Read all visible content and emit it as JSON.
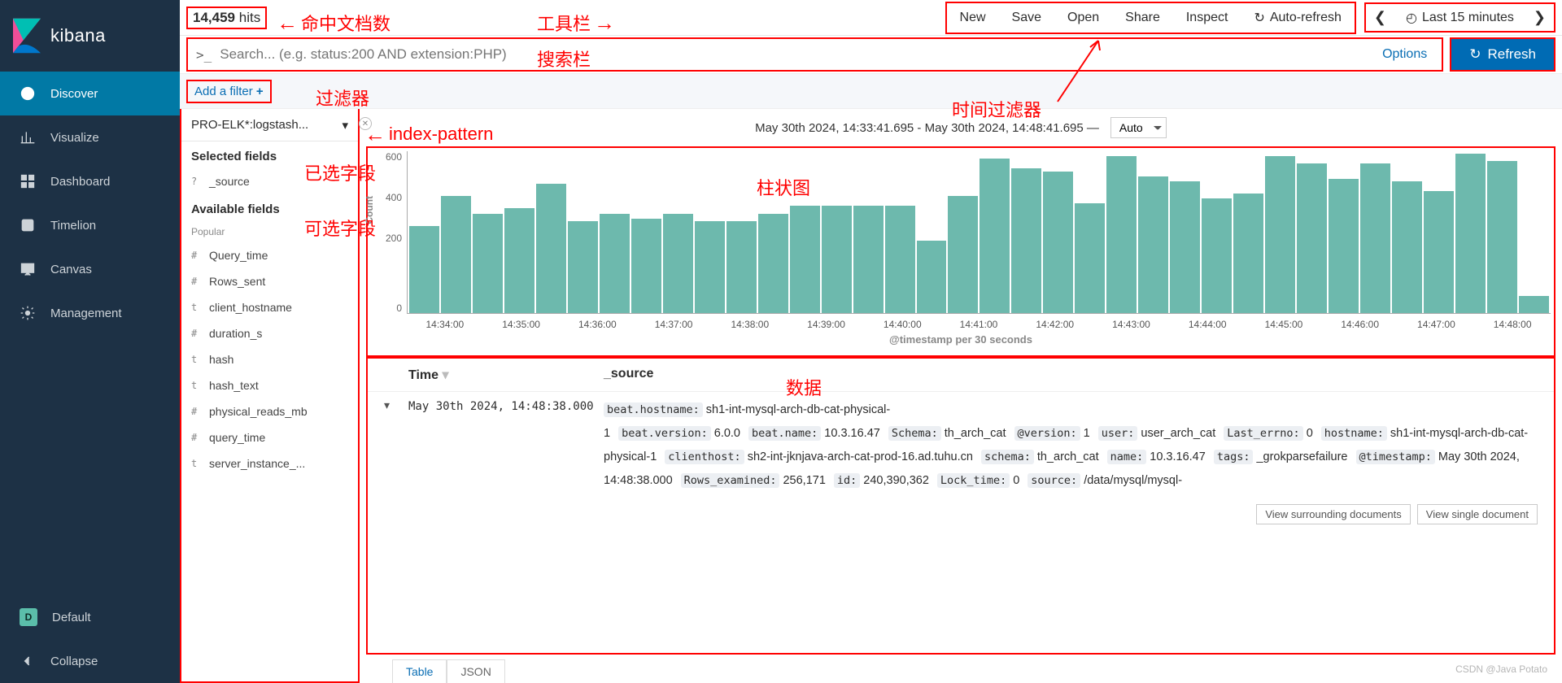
{
  "brand": "kibana",
  "nav": [
    {
      "label": "Discover",
      "icon": "compass",
      "active": true
    },
    {
      "label": "Visualize",
      "icon": "barline"
    },
    {
      "label": "Dashboard",
      "icon": "dashboard"
    },
    {
      "label": "Timelion",
      "icon": "timelion"
    },
    {
      "label": "Canvas",
      "icon": "canvas"
    },
    {
      "label": "Management",
      "icon": "gear"
    }
  ],
  "nav_bottom": [
    {
      "label": "Default",
      "icon": "badge",
      "badge": "D"
    },
    {
      "label": "Collapse",
      "icon": "collapse"
    }
  ],
  "hits": {
    "count": "14,459",
    "suffix": "hits"
  },
  "toolbar": [
    "New",
    "Save",
    "Open",
    "Share",
    "Inspect"
  ],
  "autorefresh": "Auto-refresh",
  "timerange": "Last 15 minutes",
  "search": {
    "prompt": ">_",
    "placeholder": "Search... (e.g. status:200 AND extension:PHP)",
    "options": "Options"
  },
  "refresh": "Refresh",
  "addfilter": "Add a filter",
  "indexpattern": "PRO-ELK*:logstash...",
  "fields": {
    "selected_h": "Selected fields",
    "selected": [
      {
        "t": "?",
        "n": "_source"
      }
    ],
    "available_h": "Available fields",
    "popular_h": "Popular",
    "available": [
      {
        "t": "#",
        "n": "Query_time"
      },
      {
        "t": "#",
        "n": "Rows_sent"
      },
      {
        "t": "t",
        "n": "client_hostname"
      },
      {
        "t": "#",
        "n": "duration_s"
      },
      {
        "t": "t",
        "n": "hash"
      },
      {
        "t": "t",
        "n": "hash_text"
      },
      {
        "t": "#",
        "n": "physical_reads_mb"
      },
      {
        "t": "#",
        "n": "query_time"
      },
      {
        "t": "t",
        "n": "server_instance_..."
      }
    ]
  },
  "timeheader": "May 30th 2024, 14:33:41.695 - May 30th 2024, 14:48:41.695 —",
  "interval": "Auto",
  "chart_data": {
    "type": "bar",
    "ylabel": "Count",
    "ylim": [
      0,
      650
    ],
    "yticks": [
      0,
      200,
      400,
      600
    ],
    "xlabel": "@timestamp per 30 seconds",
    "xticks": [
      "14:34:00",
      "14:35:00",
      "14:36:00",
      "14:37:00",
      "14:38:00",
      "14:39:00",
      "14:40:00",
      "14:41:00",
      "14:42:00",
      "14:43:00",
      "14:44:00",
      "14:45:00",
      "14:46:00",
      "14:47:00",
      "14:48:00"
    ],
    "values": [
      350,
      470,
      400,
      420,
      520,
      370,
      400,
      380,
      400,
      370,
      370,
      400,
      430,
      430,
      430,
      430,
      290,
      470,
      620,
      580,
      570,
      440,
      630,
      550,
      530,
      460,
      480,
      630,
      600,
      540,
      600,
      530,
      490,
      640,
      610,
      70
    ]
  },
  "table": {
    "headers": {
      "time": "Time",
      "source": "_source"
    },
    "row": {
      "time": "May 30th 2024, 14:48:38.000",
      "kv": [
        {
          "k": "beat.hostname:",
          "v": "sh1-int-mysql-arch-db-cat-physical-1"
        },
        {
          "k": "beat.version:",
          "v": "6.0.0"
        },
        {
          "k": "beat.name:",
          "v": "10.3.16.47"
        },
        {
          "k": "Schema:",
          "v": "th_arch_cat"
        },
        {
          "k": "@version:",
          "v": "1"
        },
        {
          "k": "user:",
          "v": "user_arch_cat"
        },
        {
          "k": "Last_errno:",
          "v": "0"
        },
        {
          "k": "hostname:",
          "v": "sh1-int-mysql-arch-db-cat-physical-1"
        },
        {
          "k": "clienthost:",
          "v": "sh2-int-jknjava-arch-cat-prod-16.ad.tuhu.cn"
        },
        {
          "k": "schema:",
          "v": "th_arch_cat"
        },
        {
          "k": "name:",
          "v": "10.3.16.47"
        },
        {
          "k": "tags:",
          "v": "_grokparsefailure"
        },
        {
          "k": "@timestamp:",
          "v": "May 30th 2024, 14:48:38.000"
        },
        {
          "k": "Rows_examined:",
          "v": "256,171"
        },
        {
          "k": "id:",
          "v": "240,390,362"
        },
        {
          "k": "Lock_time:",
          "v": "0"
        },
        {
          "k": "source:",
          "v": "/data/mysql/mysql-"
        }
      ]
    },
    "tabs": [
      "Table",
      "JSON"
    ],
    "docbtns": [
      "View surrounding documents",
      "View single document"
    ]
  },
  "annotations": {
    "hits": "命中文档数",
    "toolbar": "工具栏",
    "search": "搜索栏",
    "filter": "过滤器",
    "timefilter": "时间过滤器",
    "indexpattern": "index-pattern",
    "selected": "已选字段",
    "available": "可选字段",
    "chart": "柱状图",
    "data": "数据"
  },
  "watermark": "CSDN @Java Potato"
}
